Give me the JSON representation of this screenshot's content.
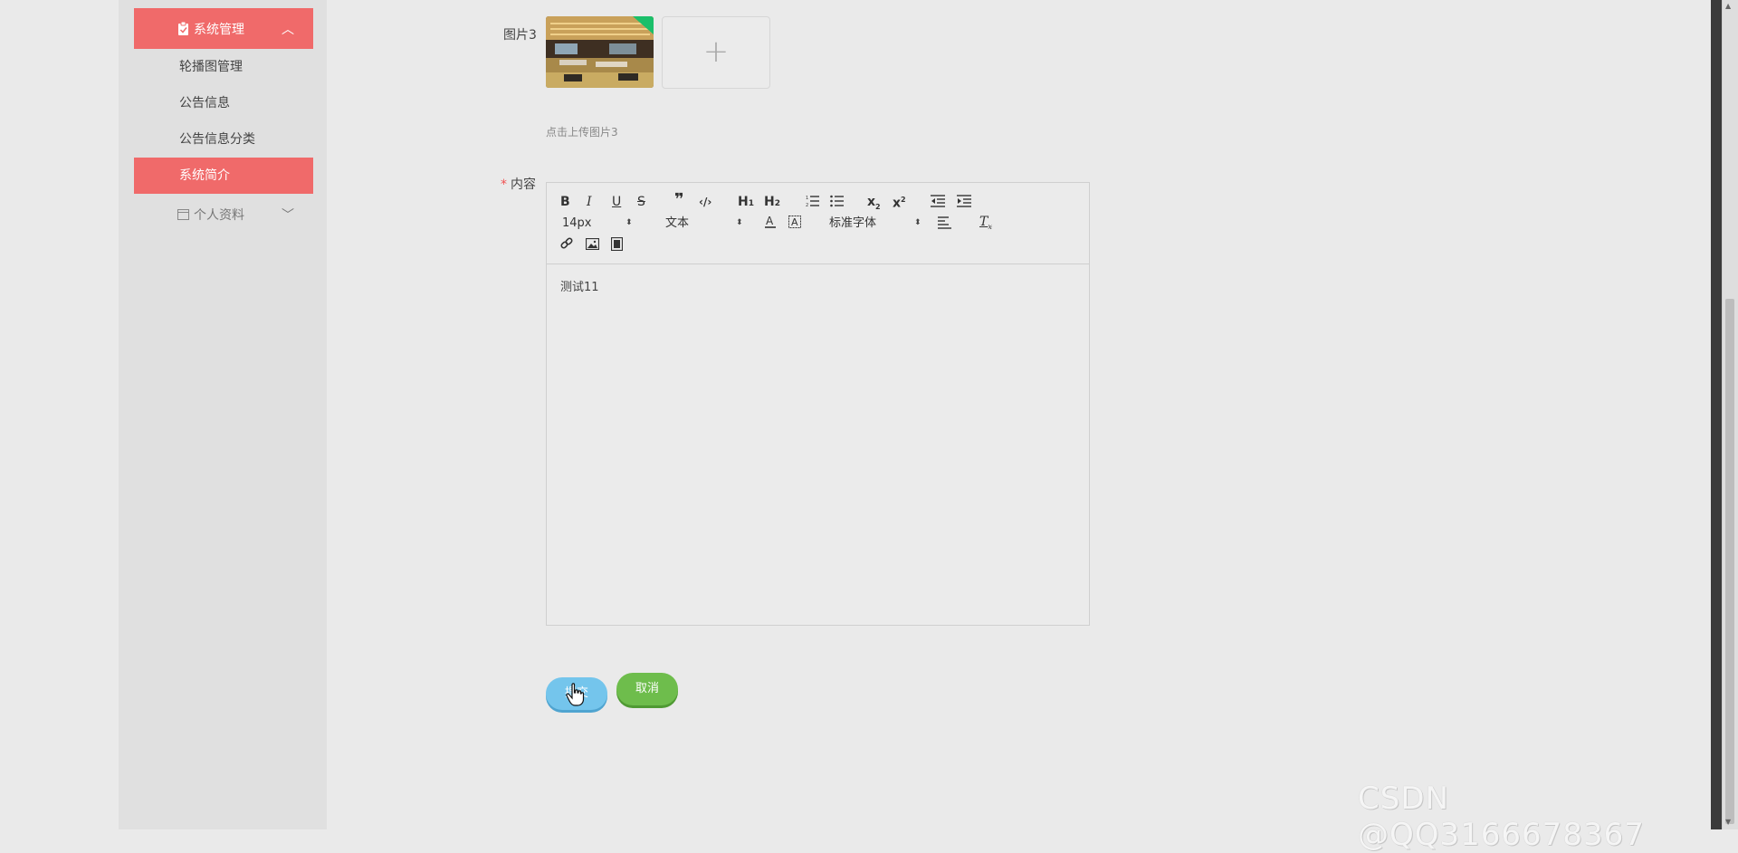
{
  "sidebar": {
    "group": {
      "label": "系统管理",
      "icon": "clipboard-icon",
      "chevron": "︿"
    },
    "items": [
      {
        "label": "轮播图管理",
        "active": false
      },
      {
        "label": "公告信息",
        "active": false
      },
      {
        "label": "公告信息分类",
        "active": false
      },
      {
        "label": "系统简介",
        "active": true
      }
    ],
    "profile": {
      "label": "个人资料",
      "icon": "calendar-icon",
      "chevron": "﹀"
    }
  },
  "form": {
    "image3": {
      "label": "图片3",
      "hint": "点击上传图片3",
      "add_symbol": "+"
    },
    "content": {
      "required_mark": "*",
      "label": "内容",
      "text": "测试11",
      "toolbar": {
        "font_size": "14px",
        "header": "文本",
        "font_family": "标准字体",
        "select_arrow": "⬍"
      }
    },
    "buttons": {
      "submit_label": "提交",
      "cancel_label": "取消"
    }
  },
  "watermark": "CSDN @QQ3166678367",
  "colors": {
    "accent": "#f06a6a",
    "submit": "#74c5ec",
    "cancel": "#6ebd4c"
  }
}
